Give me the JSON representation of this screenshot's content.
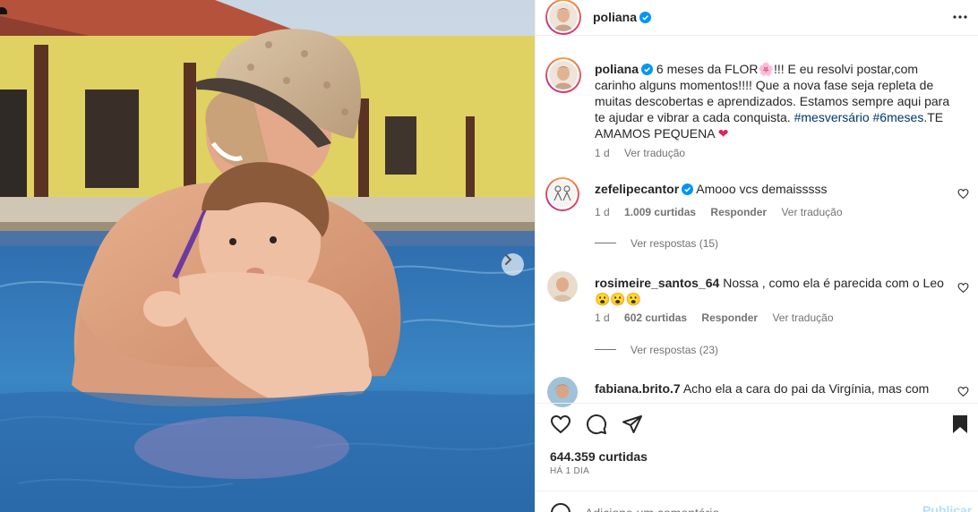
{
  "post": {
    "username": "poliana",
    "verified": true,
    "caption_prefix": "6 meses da FLOR",
    "caption_emoji": "🌸",
    "caption_body": "!!! E eu resolvi postar,com carinho alguns momentos!!!! Que a nova fase seja repleta de muitas descobertas e aprendizados. Estamos sempre aqui para te ajudar e vibrar a cada conquista.",
    "hashtag_1": "#mesversário",
    "hashtag_2": "#6meses",
    "caption_end": ".TE AMAMOS PEQUENA",
    "caption_heart": "❤",
    "caption_time": "1 d",
    "caption_translate": "Ver tradução"
  },
  "comments": [
    {
      "username": "zefelipecantor",
      "verified": true,
      "text": "Amooo vcs demaisssss",
      "time": "1 d",
      "likes": "1.009 curtidas",
      "reply": "Responder",
      "translate": "Ver tradução",
      "view_replies": "Ver respostas (15)"
    },
    {
      "username": "rosimeire_santos_64",
      "verified": false,
      "text": "Nossa , como ela é parecida com o Leo",
      "emojis": "😮😮😮",
      "time": "1 d",
      "likes": "602 curtidas",
      "reply": "Responder",
      "translate": "Ver tradução",
      "view_replies": "Ver respostas (23)"
    },
    {
      "username": "fabiana.brito.7",
      "verified": false,
      "text": "Acho ela a cara do pai da Virgínia, mas com"
    }
  ],
  "footer": {
    "likes": "644.359 curtidas",
    "posted": "HÁ 1 DIA",
    "comment_placeholder": "Adicione um comentário...",
    "publish": "Publicar"
  },
  "icons": {
    "like": "heart-icon",
    "comment": "comment-bubble-icon",
    "share": "paper-plane-icon",
    "save": "bookmark-icon",
    "more": "more-options-icon",
    "next": "chevron-right-icon",
    "emoji": "emoji-icon"
  },
  "colors": {
    "verified": "#0095f6",
    "hashtag": "#00376b",
    "muted": "#737373",
    "publish": "#b2dffc"
  }
}
